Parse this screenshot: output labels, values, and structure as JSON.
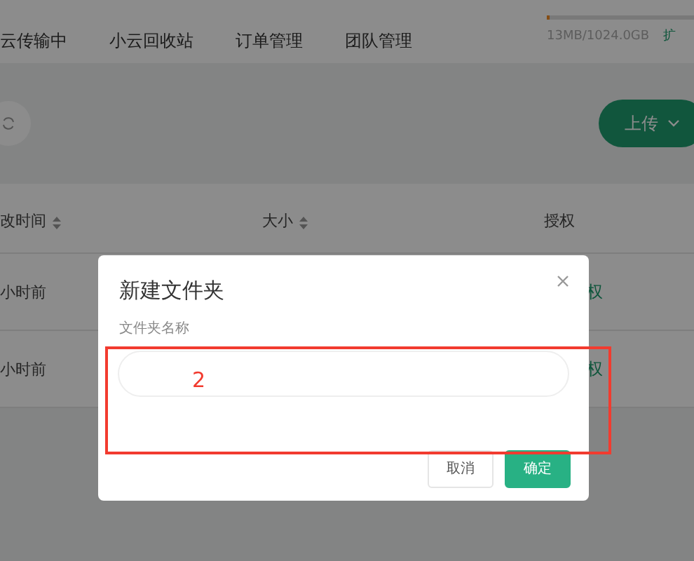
{
  "nav_tabs": [
    {
      "label": "云传输中",
      "selected": false
    },
    {
      "label": "小云回收站",
      "selected": false
    },
    {
      "label": "订单管理",
      "selected": false
    },
    {
      "label": "团队管理",
      "selected": false
    }
  ],
  "storage": {
    "level": 0.02,
    "reading": "13MB/1024.0GB",
    "action": "扩"
  },
  "toolbar": {
    "upload_button": "上传"
  },
  "table": {
    "columns": [
      {
        "label": "改时间",
        "sortable": true
      },
      {
        "label": "大小",
        "sortable": true
      },
      {
        "label": "授权",
        "sortable": false
      }
    ],
    "rows": [
      {
        "time": "小时前",
        "action": "权"
      },
      {
        "time": "小时前",
        "action": "权"
      }
    ]
  },
  "dialog": {
    "title": "新建文件夹",
    "field_label": "文件夹名称",
    "buttons": [
      {
        "label": "取消",
        "kind": "secondary"
      },
      {
        "label": "确定",
        "kind": "primary"
      }
    ]
  },
  "annotation": {
    "label": "2"
  }
}
